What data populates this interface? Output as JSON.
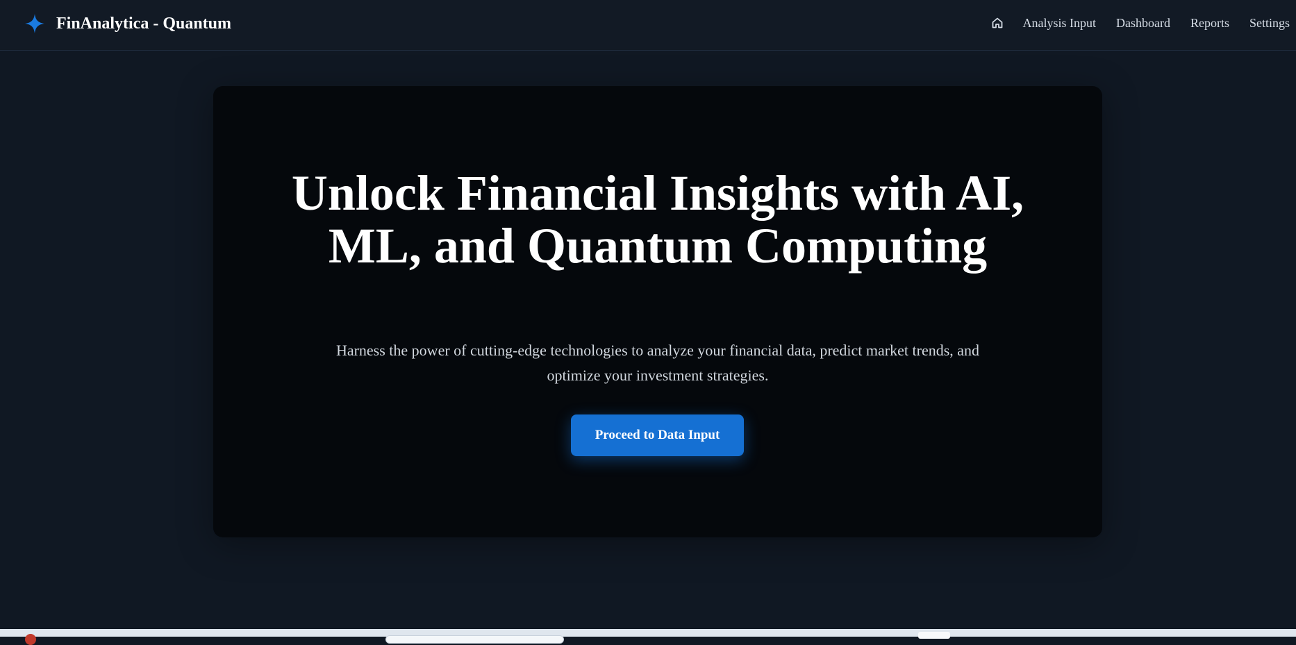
{
  "app": {
    "brand_title": "FinAnalytica - Quantum",
    "brand_icon": "sparkle-star-icon",
    "accent_color": "#1570d3"
  },
  "nav": {
    "home_icon": "home-icon",
    "links": [
      "Analysis Input",
      "Dashboard",
      "Reports",
      "Settings"
    ]
  },
  "hero": {
    "title": "Unlock Financial Insights with AI, ML, and Quantum Computing",
    "subtitle": "Harness the power of cutting-edge technologies to analyze your financial data, predict market trends, and optimize your investment strategies.",
    "cta_label": "Proceed to Data Input"
  }
}
